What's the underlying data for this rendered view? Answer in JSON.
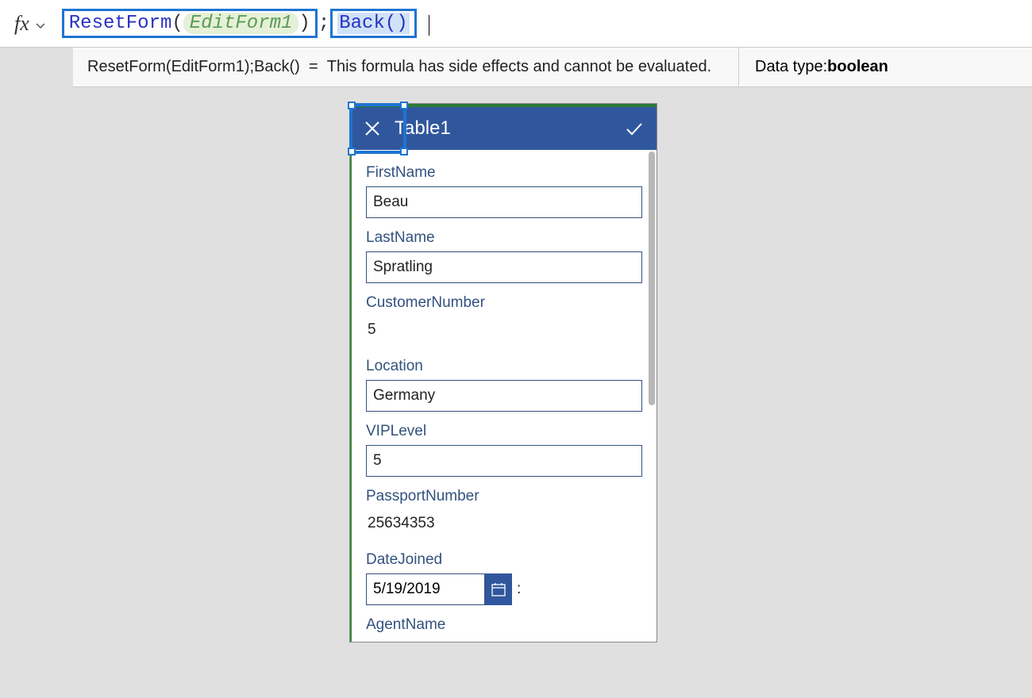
{
  "formula": {
    "fx_label": "fx",
    "highlight1": {
      "func": "ResetForm",
      "open": "(",
      "arg": "EditForm1",
      "close": ")"
    },
    "sep": ";",
    "highlight2": {
      "func": "Back",
      "parens": "()"
    }
  },
  "result": {
    "expr": "ResetForm(EditForm1);Back()",
    "eq": "=",
    "msg": "This formula has side effects and cannot be evaluated.",
    "dtype_label": "Data type: ",
    "dtype_value": "boolean"
  },
  "phone": {
    "title": "Table1",
    "fields": {
      "first_label": "FirstName",
      "first_value": "Beau",
      "last_label": "LastName",
      "last_value": "Spratling",
      "cust_label": "CustomerNumber",
      "cust_value": "5",
      "loc_label": "Location",
      "loc_value": "Germany",
      "vip_label": "VIPLevel",
      "vip_value": "5",
      "pass_label": "PassportNumber",
      "pass_value": "25634353",
      "date_label": "DateJoined",
      "date_value": "5/19/2019",
      "date_trail": ":",
      "agent_label": "AgentName"
    }
  }
}
